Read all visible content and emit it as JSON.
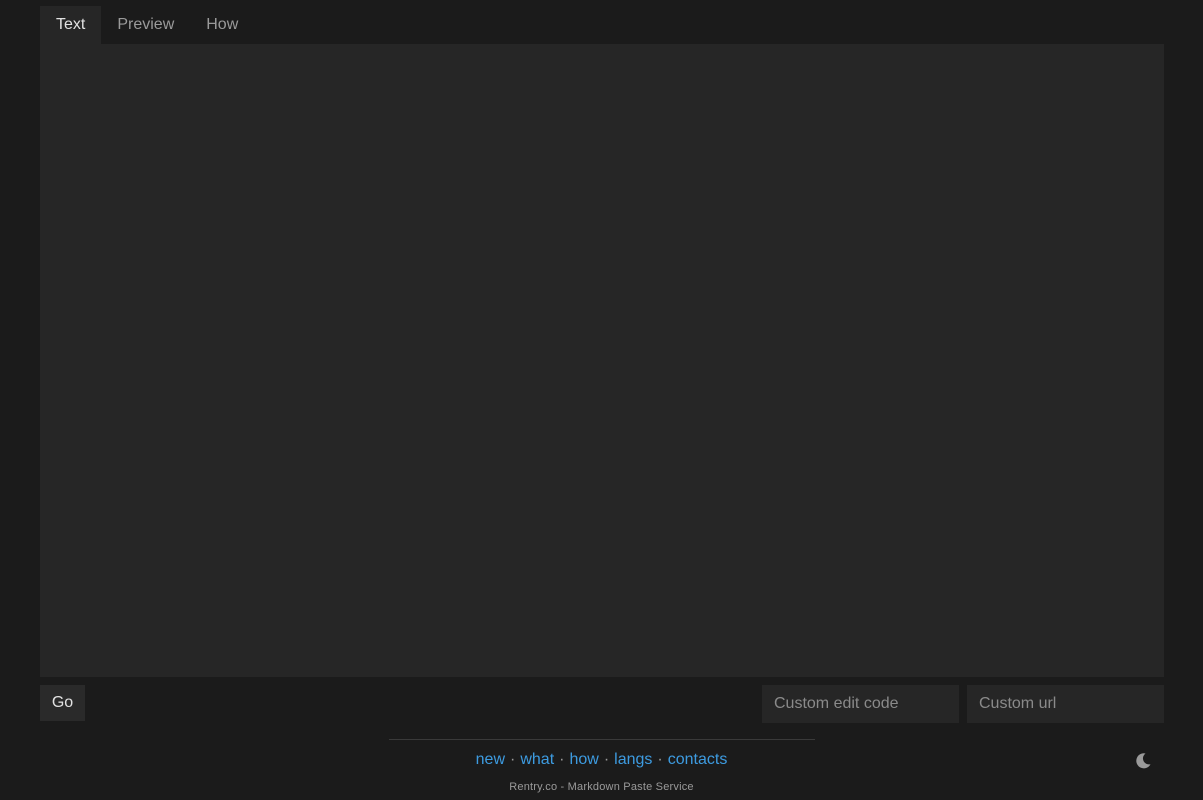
{
  "tabs": [
    {
      "label": "Text",
      "active": true
    },
    {
      "label": "Preview",
      "active": false
    },
    {
      "label": "How",
      "active": false
    }
  ],
  "editor": {
    "value": "",
    "placeholder": ""
  },
  "actions": {
    "go_label": "Go",
    "edit_code_placeholder": "Custom edit code",
    "custom_url_placeholder": "Custom url"
  },
  "footer": {
    "links": [
      "new",
      "what",
      "how",
      "langs",
      "contacts"
    ],
    "separator": "·",
    "tagline": "Rentry.co - Markdown Paste Service"
  },
  "theme_toggle": {
    "icon": "moon-icon"
  },
  "colors": {
    "background": "#1b1b1b",
    "panel": "#262626",
    "link": "#3d9be0"
  }
}
